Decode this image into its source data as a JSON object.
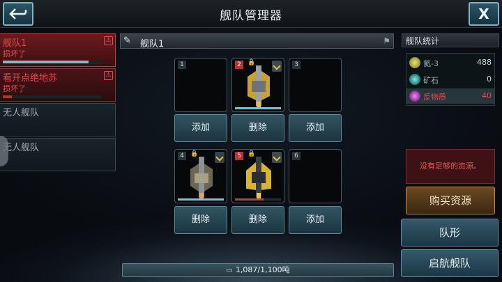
{
  "title": "舰队管理器",
  "fleets": [
    {
      "name": "舰队1",
      "status": "损坏了",
      "hp": 0.87
    },
    {
      "name": "看开点绝地苏",
      "status": "损坏了",
      "hp": 0.09
    },
    {
      "name": "无人舰队"
    },
    {
      "name": "无人舰队"
    }
  ],
  "fleet_header": {
    "label": "舰队1"
  },
  "slots": [
    {
      "num": "1",
      "button": "添加"
    },
    {
      "num": "2",
      "button": "删除",
      "hp": 1.0
    },
    {
      "num": "3",
      "button": "添加"
    },
    {
      "num": "4",
      "button": "删除",
      "hp": 1.0
    },
    {
      "num": "5",
      "button": "删除",
      "hp": 0.62
    },
    {
      "num": "6",
      "button": "添加"
    }
  ],
  "tonnage": "1,087/1,100吨",
  "stats": {
    "title": "舰队统计",
    "rows": [
      {
        "label": "氦-3",
        "value": "488",
        "color": "#c7c34a"
      },
      {
        "label": "矿石",
        "value": "0",
        "color": "#39b6b0"
      },
      {
        "label": "反物质",
        "value": "40",
        "color": "#c44bcf"
      }
    ]
  },
  "warning": "没有足够的资源。",
  "buy_button": "购买资源",
  "formation_button": "队形",
  "launch_button": "启航舰队",
  "colors": {
    "accent": "#5d8b9a",
    "danger": "#e24f4f",
    "gold": "#c98b36"
  }
}
